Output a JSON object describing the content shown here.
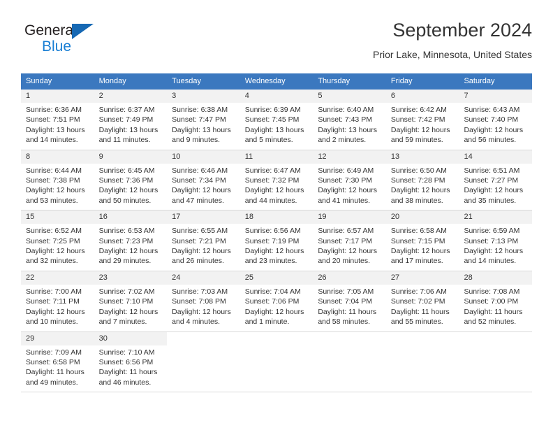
{
  "logo": {
    "word_dark": "General",
    "word_blue": "Blue",
    "triangle_color": "#1668b3",
    "blue_color": "#1a7fd4"
  },
  "header": {
    "title": "September 2024",
    "subtitle": "Prior Lake, Minnesota, United States",
    "header_bg": "#3b78bf",
    "daynum_bg": "#f2f2f2"
  },
  "weekdays": [
    "Sunday",
    "Monday",
    "Tuesday",
    "Wednesday",
    "Thursday",
    "Friday",
    "Saturday"
  ],
  "weeks": [
    [
      {
        "day": "1",
        "sunrise": "Sunrise: 6:36 AM",
        "sunset": "Sunset: 7:51 PM",
        "daylight1": "Daylight: 13 hours",
        "daylight2": "and 14 minutes."
      },
      {
        "day": "2",
        "sunrise": "Sunrise: 6:37 AM",
        "sunset": "Sunset: 7:49 PM",
        "daylight1": "Daylight: 13 hours",
        "daylight2": "and 11 minutes."
      },
      {
        "day": "3",
        "sunrise": "Sunrise: 6:38 AM",
        "sunset": "Sunset: 7:47 PM",
        "daylight1": "Daylight: 13 hours",
        "daylight2": "and 9 minutes."
      },
      {
        "day": "4",
        "sunrise": "Sunrise: 6:39 AM",
        "sunset": "Sunset: 7:45 PM",
        "daylight1": "Daylight: 13 hours",
        "daylight2": "and 5 minutes."
      },
      {
        "day": "5",
        "sunrise": "Sunrise: 6:40 AM",
        "sunset": "Sunset: 7:43 PM",
        "daylight1": "Daylight: 13 hours",
        "daylight2": "and 2 minutes."
      },
      {
        "day": "6",
        "sunrise": "Sunrise: 6:42 AM",
        "sunset": "Sunset: 7:42 PM",
        "daylight1": "Daylight: 12 hours",
        "daylight2": "and 59 minutes."
      },
      {
        "day": "7",
        "sunrise": "Sunrise: 6:43 AM",
        "sunset": "Sunset: 7:40 PM",
        "daylight1": "Daylight: 12 hours",
        "daylight2": "and 56 minutes."
      }
    ],
    [
      {
        "day": "8",
        "sunrise": "Sunrise: 6:44 AM",
        "sunset": "Sunset: 7:38 PM",
        "daylight1": "Daylight: 12 hours",
        "daylight2": "and 53 minutes."
      },
      {
        "day": "9",
        "sunrise": "Sunrise: 6:45 AM",
        "sunset": "Sunset: 7:36 PM",
        "daylight1": "Daylight: 12 hours",
        "daylight2": "and 50 minutes."
      },
      {
        "day": "10",
        "sunrise": "Sunrise: 6:46 AM",
        "sunset": "Sunset: 7:34 PM",
        "daylight1": "Daylight: 12 hours",
        "daylight2": "and 47 minutes."
      },
      {
        "day": "11",
        "sunrise": "Sunrise: 6:47 AM",
        "sunset": "Sunset: 7:32 PM",
        "daylight1": "Daylight: 12 hours",
        "daylight2": "and 44 minutes."
      },
      {
        "day": "12",
        "sunrise": "Sunrise: 6:49 AM",
        "sunset": "Sunset: 7:30 PM",
        "daylight1": "Daylight: 12 hours",
        "daylight2": "and 41 minutes."
      },
      {
        "day": "13",
        "sunrise": "Sunrise: 6:50 AM",
        "sunset": "Sunset: 7:28 PM",
        "daylight1": "Daylight: 12 hours",
        "daylight2": "and 38 minutes."
      },
      {
        "day": "14",
        "sunrise": "Sunrise: 6:51 AM",
        "sunset": "Sunset: 7:27 PM",
        "daylight1": "Daylight: 12 hours",
        "daylight2": "and 35 minutes."
      }
    ],
    [
      {
        "day": "15",
        "sunrise": "Sunrise: 6:52 AM",
        "sunset": "Sunset: 7:25 PM",
        "daylight1": "Daylight: 12 hours",
        "daylight2": "and 32 minutes."
      },
      {
        "day": "16",
        "sunrise": "Sunrise: 6:53 AM",
        "sunset": "Sunset: 7:23 PM",
        "daylight1": "Daylight: 12 hours",
        "daylight2": "and 29 minutes."
      },
      {
        "day": "17",
        "sunrise": "Sunrise: 6:55 AM",
        "sunset": "Sunset: 7:21 PM",
        "daylight1": "Daylight: 12 hours",
        "daylight2": "and 26 minutes."
      },
      {
        "day": "18",
        "sunrise": "Sunrise: 6:56 AM",
        "sunset": "Sunset: 7:19 PM",
        "daylight1": "Daylight: 12 hours",
        "daylight2": "and 23 minutes."
      },
      {
        "day": "19",
        "sunrise": "Sunrise: 6:57 AM",
        "sunset": "Sunset: 7:17 PM",
        "daylight1": "Daylight: 12 hours",
        "daylight2": "and 20 minutes."
      },
      {
        "day": "20",
        "sunrise": "Sunrise: 6:58 AM",
        "sunset": "Sunset: 7:15 PM",
        "daylight1": "Daylight: 12 hours",
        "daylight2": "and 17 minutes."
      },
      {
        "day": "21",
        "sunrise": "Sunrise: 6:59 AM",
        "sunset": "Sunset: 7:13 PM",
        "daylight1": "Daylight: 12 hours",
        "daylight2": "and 14 minutes."
      }
    ],
    [
      {
        "day": "22",
        "sunrise": "Sunrise: 7:00 AM",
        "sunset": "Sunset: 7:11 PM",
        "daylight1": "Daylight: 12 hours",
        "daylight2": "and 10 minutes."
      },
      {
        "day": "23",
        "sunrise": "Sunrise: 7:02 AM",
        "sunset": "Sunset: 7:10 PM",
        "daylight1": "Daylight: 12 hours",
        "daylight2": "and 7 minutes."
      },
      {
        "day": "24",
        "sunrise": "Sunrise: 7:03 AM",
        "sunset": "Sunset: 7:08 PM",
        "daylight1": "Daylight: 12 hours",
        "daylight2": "and 4 minutes."
      },
      {
        "day": "25",
        "sunrise": "Sunrise: 7:04 AM",
        "sunset": "Sunset: 7:06 PM",
        "daylight1": "Daylight: 12 hours",
        "daylight2": "and 1 minute."
      },
      {
        "day": "26",
        "sunrise": "Sunrise: 7:05 AM",
        "sunset": "Sunset: 7:04 PM",
        "daylight1": "Daylight: 11 hours",
        "daylight2": "and 58 minutes."
      },
      {
        "day": "27",
        "sunrise": "Sunrise: 7:06 AM",
        "sunset": "Sunset: 7:02 PM",
        "daylight1": "Daylight: 11 hours",
        "daylight2": "and 55 minutes."
      },
      {
        "day": "28",
        "sunrise": "Sunrise: 7:08 AM",
        "sunset": "Sunset: 7:00 PM",
        "daylight1": "Daylight: 11 hours",
        "daylight2": "and 52 minutes."
      }
    ],
    [
      {
        "day": "29",
        "sunrise": "Sunrise: 7:09 AM",
        "sunset": "Sunset: 6:58 PM",
        "daylight1": "Daylight: 11 hours",
        "daylight2": "and 49 minutes."
      },
      {
        "day": "30",
        "sunrise": "Sunrise: 7:10 AM",
        "sunset": "Sunset: 6:56 PM",
        "daylight1": "Daylight: 11 hours",
        "daylight2": "and 46 minutes."
      },
      {
        "day": "",
        "sunrise": "",
        "sunset": "",
        "daylight1": "",
        "daylight2": ""
      },
      {
        "day": "",
        "sunrise": "",
        "sunset": "",
        "daylight1": "",
        "daylight2": ""
      },
      {
        "day": "",
        "sunrise": "",
        "sunset": "",
        "daylight1": "",
        "daylight2": ""
      },
      {
        "day": "",
        "sunrise": "",
        "sunset": "",
        "daylight1": "",
        "daylight2": ""
      },
      {
        "day": "",
        "sunrise": "",
        "sunset": "",
        "daylight1": "",
        "daylight2": ""
      }
    ]
  ]
}
